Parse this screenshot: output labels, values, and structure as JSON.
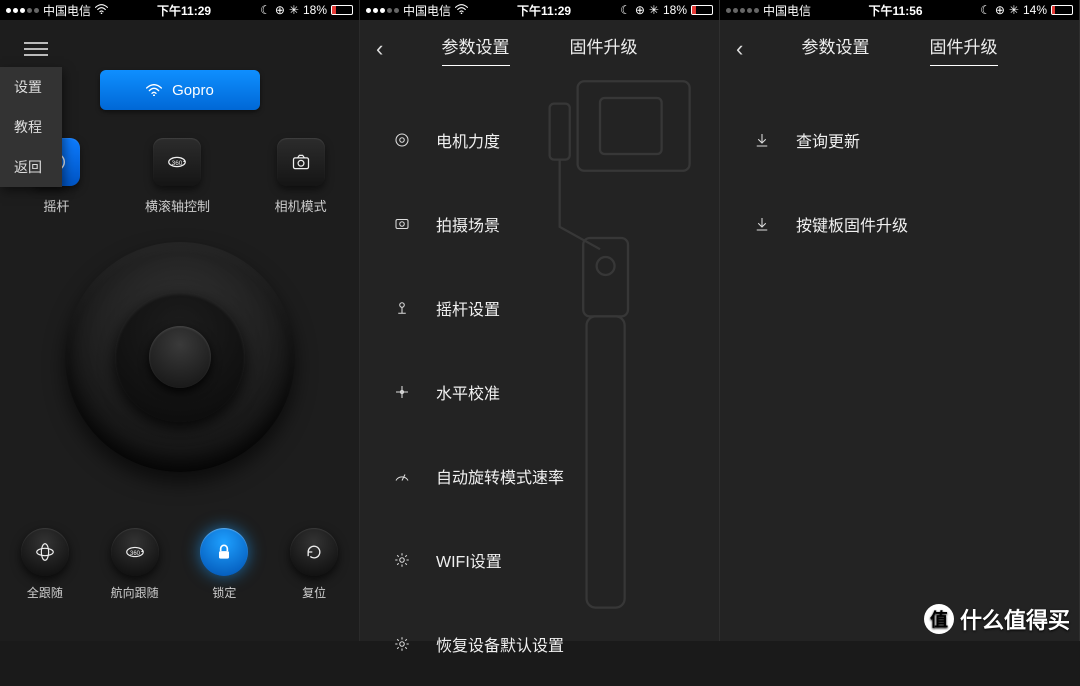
{
  "statusbar": {
    "carrier": "中国电信",
    "time1": "下午11:29",
    "time2": "下午11:29",
    "time3": "下午11:56",
    "batt1_pct": "18%",
    "batt2_pct": "18%",
    "batt3_pct": "14%"
  },
  "screen1": {
    "sidemenu": {
      "item0": "设置",
      "item1": "教程",
      "item2": "返回"
    },
    "gopro_label": "Gopro",
    "modes": {
      "m0": "摇杆",
      "m1": "横滚轴控制",
      "m2": "相机模式"
    },
    "bottom": {
      "b0": "全跟随",
      "b1": "航向跟随",
      "b2": "锁定",
      "b3": "复位"
    }
  },
  "nav": {
    "tab_params": "参数设置",
    "tab_firmware": "固件升级"
  },
  "screen2": {
    "items": {
      "i0": "电机力度",
      "i1": "拍摄场景",
      "i2": "摇杆设置",
      "i3": "水平校准",
      "i4": "自动旋转模式速率",
      "i5": "WIFI设置",
      "i6": "恢复设备默认设置"
    }
  },
  "screen3": {
    "items": {
      "i0": "查询更新",
      "i1": "按键板固件升级"
    }
  },
  "watermark": "什么值得买"
}
